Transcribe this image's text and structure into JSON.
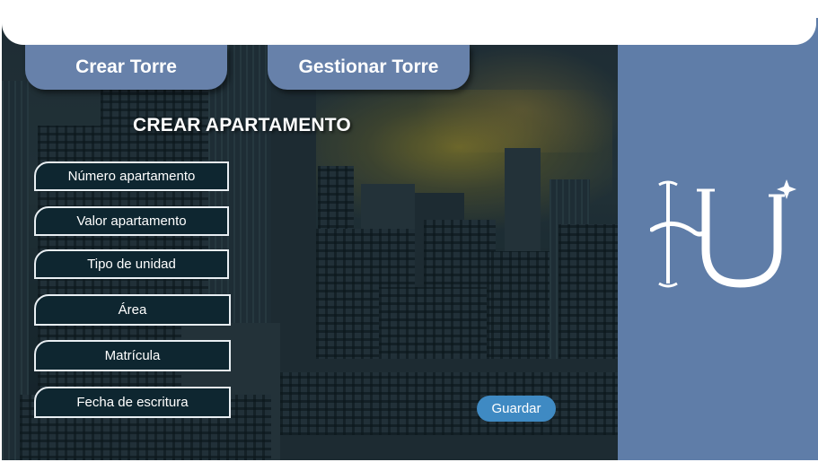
{
  "tabs": {
    "crear_torre": "Crear Torre",
    "gestionar_torre": "Gestionar Torre"
  },
  "form": {
    "title": "CREAR APARTAMENTO",
    "fields": [
      "Número apartamento",
      "Valor apartamento",
      "Tipo de unidad",
      "Área",
      "Matrícula",
      "Fecha de escritura"
    ],
    "save_label": "Guardar"
  },
  "logo": {
    "icon": "hu-monogram-logo"
  },
  "colors": {
    "tab_blue": "#6781aa",
    "side_panel": "#5f7da8",
    "field_bg": "#0e2630",
    "save_button": "#3f8ac3"
  }
}
